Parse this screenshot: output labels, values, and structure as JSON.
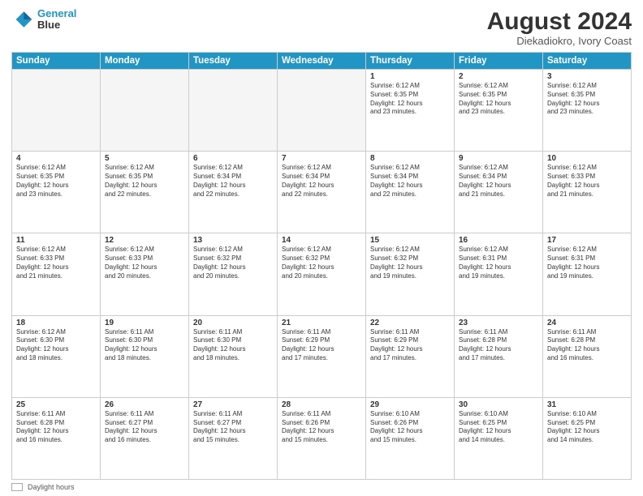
{
  "header": {
    "logo_line1": "General",
    "logo_line2": "Blue",
    "main_title": "August 2024",
    "sub_title": "Diekadiokro, Ivory Coast"
  },
  "days_of_week": [
    "Sunday",
    "Monday",
    "Tuesday",
    "Wednesday",
    "Thursday",
    "Friday",
    "Saturday"
  ],
  "weeks": [
    [
      {
        "day": "",
        "info": ""
      },
      {
        "day": "",
        "info": ""
      },
      {
        "day": "",
        "info": ""
      },
      {
        "day": "",
        "info": ""
      },
      {
        "day": "1",
        "info": "Sunrise: 6:12 AM\nSunset: 6:35 PM\nDaylight: 12 hours\nand 23 minutes."
      },
      {
        "day": "2",
        "info": "Sunrise: 6:12 AM\nSunset: 6:35 PM\nDaylight: 12 hours\nand 23 minutes."
      },
      {
        "day": "3",
        "info": "Sunrise: 6:12 AM\nSunset: 6:35 PM\nDaylight: 12 hours\nand 23 minutes."
      }
    ],
    [
      {
        "day": "4",
        "info": "Sunrise: 6:12 AM\nSunset: 6:35 PM\nDaylight: 12 hours\nand 23 minutes."
      },
      {
        "day": "5",
        "info": "Sunrise: 6:12 AM\nSunset: 6:35 PM\nDaylight: 12 hours\nand 22 minutes."
      },
      {
        "day": "6",
        "info": "Sunrise: 6:12 AM\nSunset: 6:34 PM\nDaylight: 12 hours\nand 22 minutes."
      },
      {
        "day": "7",
        "info": "Sunrise: 6:12 AM\nSunset: 6:34 PM\nDaylight: 12 hours\nand 22 minutes."
      },
      {
        "day": "8",
        "info": "Sunrise: 6:12 AM\nSunset: 6:34 PM\nDaylight: 12 hours\nand 22 minutes."
      },
      {
        "day": "9",
        "info": "Sunrise: 6:12 AM\nSunset: 6:34 PM\nDaylight: 12 hours\nand 21 minutes."
      },
      {
        "day": "10",
        "info": "Sunrise: 6:12 AM\nSunset: 6:33 PM\nDaylight: 12 hours\nand 21 minutes."
      }
    ],
    [
      {
        "day": "11",
        "info": "Sunrise: 6:12 AM\nSunset: 6:33 PM\nDaylight: 12 hours\nand 21 minutes."
      },
      {
        "day": "12",
        "info": "Sunrise: 6:12 AM\nSunset: 6:33 PM\nDaylight: 12 hours\nand 20 minutes."
      },
      {
        "day": "13",
        "info": "Sunrise: 6:12 AM\nSunset: 6:32 PM\nDaylight: 12 hours\nand 20 minutes."
      },
      {
        "day": "14",
        "info": "Sunrise: 6:12 AM\nSunset: 6:32 PM\nDaylight: 12 hours\nand 20 minutes."
      },
      {
        "day": "15",
        "info": "Sunrise: 6:12 AM\nSunset: 6:32 PM\nDaylight: 12 hours\nand 19 minutes."
      },
      {
        "day": "16",
        "info": "Sunrise: 6:12 AM\nSunset: 6:31 PM\nDaylight: 12 hours\nand 19 minutes."
      },
      {
        "day": "17",
        "info": "Sunrise: 6:12 AM\nSunset: 6:31 PM\nDaylight: 12 hours\nand 19 minutes."
      }
    ],
    [
      {
        "day": "18",
        "info": "Sunrise: 6:12 AM\nSunset: 6:30 PM\nDaylight: 12 hours\nand 18 minutes."
      },
      {
        "day": "19",
        "info": "Sunrise: 6:11 AM\nSunset: 6:30 PM\nDaylight: 12 hours\nand 18 minutes."
      },
      {
        "day": "20",
        "info": "Sunrise: 6:11 AM\nSunset: 6:30 PM\nDaylight: 12 hours\nand 18 minutes."
      },
      {
        "day": "21",
        "info": "Sunrise: 6:11 AM\nSunset: 6:29 PM\nDaylight: 12 hours\nand 17 minutes."
      },
      {
        "day": "22",
        "info": "Sunrise: 6:11 AM\nSunset: 6:29 PM\nDaylight: 12 hours\nand 17 minutes."
      },
      {
        "day": "23",
        "info": "Sunrise: 6:11 AM\nSunset: 6:28 PM\nDaylight: 12 hours\nand 17 minutes."
      },
      {
        "day": "24",
        "info": "Sunrise: 6:11 AM\nSunset: 6:28 PM\nDaylight: 12 hours\nand 16 minutes."
      }
    ],
    [
      {
        "day": "25",
        "info": "Sunrise: 6:11 AM\nSunset: 6:28 PM\nDaylight: 12 hours\nand 16 minutes."
      },
      {
        "day": "26",
        "info": "Sunrise: 6:11 AM\nSunset: 6:27 PM\nDaylight: 12 hours\nand 16 minutes."
      },
      {
        "day": "27",
        "info": "Sunrise: 6:11 AM\nSunset: 6:27 PM\nDaylight: 12 hours\nand 15 minutes."
      },
      {
        "day": "28",
        "info": "Sunrise: 6:11 AM\nSunset: 6:26 PM\nDaylight: 12 hours\nand 15 minutes."
      },
      {
        "day": "29",
        "info": "Sunrise: 6:10 AM\nSunset: 6:26 PM\nDaylight: 12 hours\nand 15 minutes."
      },
      {
        "day": "30",
        "info": "Sunrise: 6:10 AM\nSunset: 6:25 PM\nDaylight: 12 hours\nand 14 minutes."
      },
      {
        "day": "31",
        "info": "Sunrise: 6:10 AM\nSunset: 6:25 PM\nDaylight: 12 hours\nand 14 minutes."
      }
    ]
  ],
  "footer": {
    "daylight_label": "Daylight hours"
  }
}
